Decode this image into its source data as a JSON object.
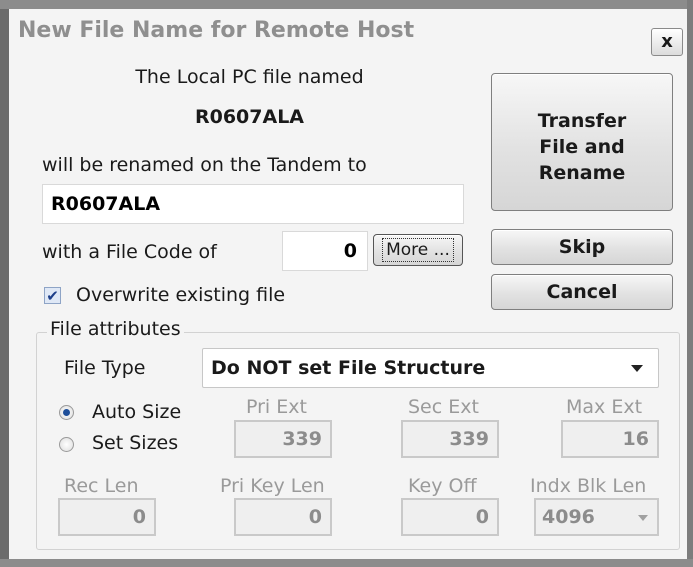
{
  "dialog": {
    "title": "New File Name for Remote Host",
    "close_label": "x"
  },
  "message": {
    "line1": "The Local PC file named",
    "local_filename": "R0607ALA",
    "line2": "will be renamed on the Tandem to"
  },
  "remote_name": {
    "value": "R0607ALA"
  },
  "file_code": {
    "label": "with a File Code of",
    "value": "0",
    "more_label": "More ..."
  },
  "overwrite": {
    "label": "Overwrite existing file",
    "checked": true,
    "check_glyph": "✔"
  },
  "buttons": {
    "transfer_line1": "Transfer",
    "transfer_line2": "File and",
    "transfer_line3": "Rename",
    "skip": "Skip",
    "cancel": "Cancel"
  },
  "attributes": {
    "group_label": "File attributes",
    "file_type_label": "File Type",
    "file_type_value": "Do NOT set File Structure",
    "size_options": [
      {
        "label": "Auto Size",
        "selected": true
      },
      {
        "label": "Set Sizes",
        "selected": false
      }
    ],
    "pri_ext": {
      "label": "Pri Ext",
      "value": "339"
    },
    "sec_ext": {
      "label": "Sec Ext",
      "value": "339"
    },
    "max_ext": {
      "label": "Max Ext",
      "value": "16"
    },
    "rec_len": {
      "label": "Rec Len",
      "value": "0"
    },
    "pri_key_len": {
      "label": "Pri Key Len",
      "value": "0"
    },
    "key_off": {
      "label": "Key Off",
      "value": "0"
    },
    "indx_blk_len": {
      "label": "Indx Blk Len",
      "value": "4096"
    }
  },
  "colors": {
    "disabled_text": "#9a9a9a",
    "radio_selected": "#1e4f9a",
    "title_text": "#8f8f8f"
  }
}
